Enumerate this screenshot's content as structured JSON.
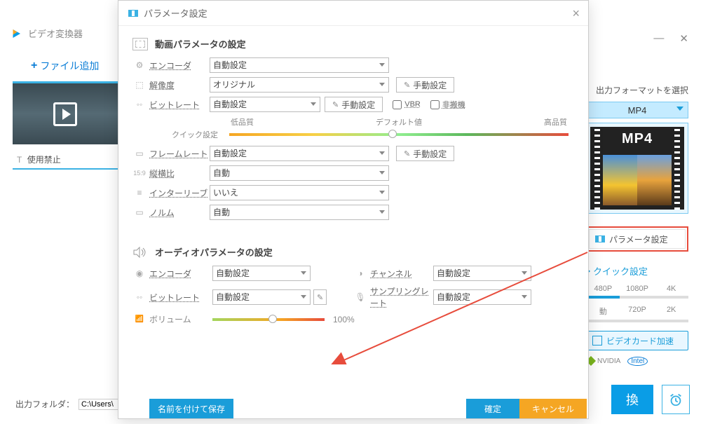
{
  "main": {
    "title": "ビデオ変換器",
    "add_file": "ファイル追加",
    "thumb_banned": "使用禁止",
    "output_folder_label": "出力フォルダ：",
    "output_folder_value": "C:\\Users\\",
    "convert_btn": "換"
  },
  "right": {
    "select_format": "出力フォーマットを選択",
    "format": "MP4",
    "mp4_badge": "MP4",
    "param_settings": "パラメータ設定",
    "quick_settings": "クイック設定",
    "res1": [
      "480P",
      "1080P",
      "4K"
    ],
    "res2": [
      "動",
      "720P",
      "2K"
    ],
    "gpu_accel": "ビデオカード加速",
    "nvidia": "NVIDIA",
    "intel": "Intel"
  },
  "modal": {
    "title": "パラメータ設定",
    "video_section": "動画パラメータの設定",
    "audio_section": "オーディオパラメータの設定",
    "labels": {
      "encoder": "エンコーダ",
      "resolution": "解像度",
      "bitrate": "ビットレート",
      "quick": "クイック設定",
      "low_q": "低品質",
      "default_q": "デフォルト値",
      "high_q": "高品質",
      "framerate": "フレームレート",
      "aspect": "縦横比",
      "interleave": "インターリーブ",
      "norm": "ノルム",
      "channel": "チャンネル",
      "sampling": "サンプリングレート",
      "volume": "ボリューム"
    },
    "values": {
      "auto": "自動設定",
      "original": "オリジナル",
      "auto_short": "自動",
      "no": "いいえ",
      "manual": "手動設定",
      "vbr": "VBR",
      "hiden": "非搬機",
      "volume_pct": "100%"
    },
    "footer": {
      "save_as": "名前を付けて保存",
      "confirm": "確定",
      "cancel": "キャンセル"
    }
  }
}
